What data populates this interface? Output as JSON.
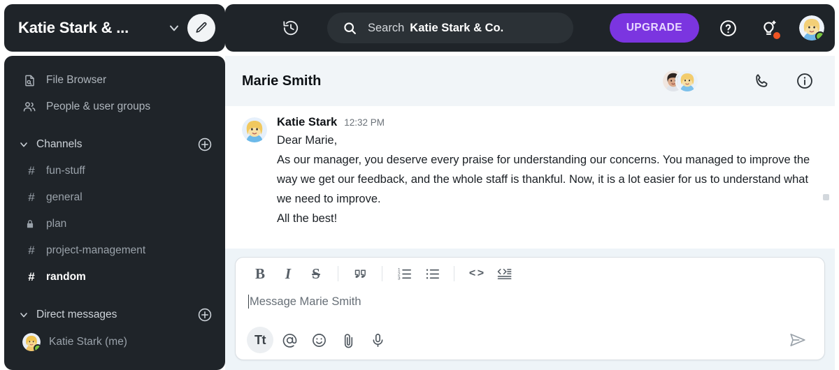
{
  "workspace": {
    "name": "Katie Stark & ...",
    "chevron_icon": "chevron-down-icon",
    "compose_icon": "pencil-icon"
  },
  "sidebar": {
    "nav": [
      {
        "label": "File Browser",
        "icon": "file-search-icon"
      },
      {
        "label": "People & user groups",
        "icon": "people-icon"
      }
    ],
    "sections": [
      {
        "title": "Channels",
        "caret_icon": "chevron-down-icon",
        "add_icon": "plus-circle-icon",
        "items": [
          {
            "label": "fun-stuff",
            "icon": "hash-icon",
            "active": false
          },
          {
            "label": "general",
            "icon": "hash-icon",
            "active": false
          },
          {
            "label": "plan",
            "icon": "lock-icon",
            "active": false
          },
          {
            "label": "project-management",
            "icon": "hash-icon",
            "active": false
          },
          {
            "label": "random",
            "icon": "hash-icon",
            "active": true
          }
        ]
      },
      {
        "title": "Direct messages",
        "caret_icon": "chevron-down-icon",
        "add_icon": "plus-circle-icon",
        "items": [
          {
            "label": "Katie Stark (me)",
            "icon": "avatar",
            "status": "online"
          }
        ]
      }
    ]
  },
  "topbar": {
    "history_icon": "history-clock-icon",
    "search": {
      "icon": "search-icon",
      "label": "Search",
      "value": "Katie Stark & Co."
    },
    "upgrade_label": "UPGRADE",
    "help_icon": "question-circle-icon",
    "ideas_icon": "lightbulb-sparkle-icon",
    "ideas_badge_color": "#f05423",
    "user_avatar": "avatar-katie",
    "user_status": "online",
    "accent_color": "#7b35e0"
  },
  "chat": {
    "title": "Marie Smith",
    "header_avatars": [
      "avatar-marie",
      "avatar-katie"
    ],
    "call_icon": "phone-icon",
    "info_icon": "info-circle-icon",
    "message": {
      "avatar": "avatar-katie",
      "author": "Katie Stark",
      "time": "12:32 PM",
      "lines": [
        "Dear Marie,",
        "As our manager, you deserve every praise for understanding our concerns. You managed to improve the way we get our feedback, and the whole staff is thankful. Now, it is a lot easier for us to understand what we need to improve.",
        "All the best!"
      ]
    }
  },
  "composer": {
    "format_tools": [
      {
        "name": "bold",
        "glyph": "B"
      },
      {
        "name": "italic",
        "glyph": "I"
      },
      {
        "name": "strikethrough",
        "glyph": "S"
      },
      {
        "name": "blockquote",
        "glyph": "””"
      },
      {
        "name": "ordered-list",
        "glyph": ""
      },
      {
        "name": "bulleted-list",
        "glyph": ""
      },
      {
        "name": "inline-code",
        "glyph": "< >"
      },
      {
        "name": "code-block",
        "glyph": ""
      }
    ],
    "placeholder": "Message Marie Smith",
    "input_value": "",
    "actions": [
      {
        "name": "text-formatting",
        "glyph": "Tt",
        "active": true
      },
      {
        "name": "mention",
        "glyph": "@",
        "active": false
      },
      {
        "name": "emoji",
        "glyph": "☺",
        "active": false
      },
      {
        "name": "attachment",
        "glyph": "",
        "active": false
      },
      {
        "name": "voice-message",
        "glyph": "",
        "active": false
      }
    ],
    "send_icon": "send-plane-icon"
  }
}
